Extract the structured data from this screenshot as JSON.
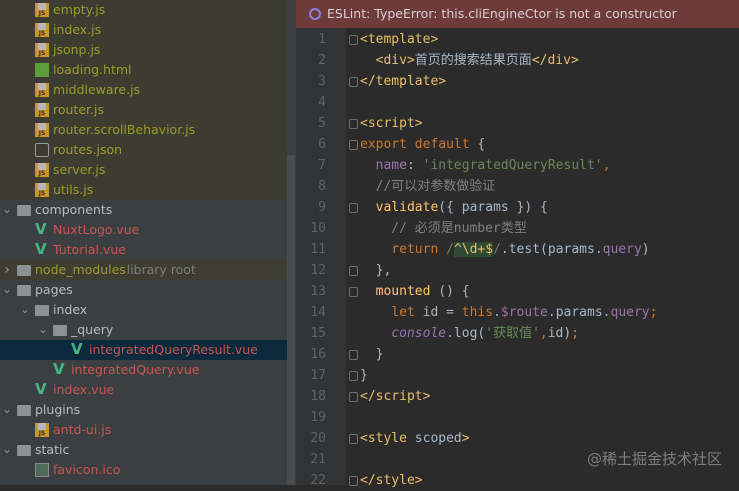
{
  "tree": [
    {
      "label": "empty.js",
      "icon": "js",
      "level": 1,
      "color": "olive",
      "bg": "olive"
    },
    {
      "label": "index.js",
      "icon": "js",
      "level": 1,
      "color": "olive",
      "bg": "olive"
    },
    {
      "label": "jsonp.js",
      "icon": "js",
      "level": 1,
      "color": "olive",
      "bg": "olive"
    },
    {
      "label": "loading.html",
      "icon": "html",
      "level": 1,
      "color": "olive",
      "bg": "olive"
    },
    {
      "label": "middleware.js",
      "icon": "js",
      "level": 1,
      "color": "olive",
      "bg": "olive"
    },
    {
      "label": "router.js",
      "icon": "js",
      "level": 1,
      "color": "olive",
      "bg": "olive"
    },
    {
      "label": "router.scrollBehavior.js",
      "icon": "js",
      "level": 1,
      "color": "olive",
      "bg": "olive"
    },
    {
      "label": "routes.json",
      "icon": "json",
      "level": 1,
      "color": "olive",
      "bg": "olive"
    },
    {
      "label": "server.js",
      "icon": "js",
      "level": 1,
      "color": "olive",
      "bg": "olive"
    },
    {
      "label": "utils.js",
      "icon": "js",
      "level": 1,
      "color": "olive",
      "bg": "olive"
    },
    {
      "label": "components",
      "icon": "folder",
      "level": 0,
      "color": "grey",
      "chevron": "open"
    },
    {
      "label": "NuxtLogo.vue",
      "icon": "vue",
      "level": 1,
      "color": "red"
    },
    {
      "label": "Tutorial.vue",
      "icon": "vue",
      "level": 1,
      "color": "red"
    },
    {
      "label": "node_modules",
      "suffix": "library root",
      "icon": "folder",
      "level": 0,
      "color": "olive",
      "chevron": "closed",
      "bg": "nm"
    },
    {
      "label": "pages",
      "icon": "folder",
      "level": 0,
      "color": "grey",
      "chevron": "open"
    },
    {
      "label": "index",
      "icon": "folder",
      "level": 1,
      "color": "grey",
      "chevron": "open"
    },
    {
      "label": "_query",
      "icon": "folder",
      "level": 2,
      "color": "grey",
      "chevron": "open"
    },
    {
      "label": "integratedQueryResult.vue",
      "icon": "vue",
      "level": 3,
      "color": "red",
      "bg": "sel"
    },
    {
      "label": "integratedQuery.vue",
      "icon": "vue",
      "level": 2,
      "color": "red"
    },
    {
      "label": "index.vue",
      "icon": "vue",
      "level": 1,
      "color": "red"
    },
    {
      "label": "plugins",
      "icon": "folder",
      "level": 0,
      "color": "grey",
      "chevron": "open"
    },
    {
      "label": "antd-ui.js",
      "icon": "js",
      "level": 1,
      "color": "red"
    },
    {
      "label": "static",
      "icon": "folder",
      "level": 0,
      "color": "grey",
      "chevron": "open"
    },
    {
      "label": "favicon.ico",
      "icon": "image",
      "level": 1,
      "color": "red"
    }
  ],
  "banner": {
    "text": "ESLint: TypeError: this.cliEngineCtor is not a constructor",
    "icon": "eslint-error-icon"
  },
  "code": [
    {
      "n": "1",
      "fold": true,
      "t": [
        [
          "tag",
          "<template>"
        ]
      ]
    },
    {
      "n": "2",
      "t": [
        [
          "",
          "  "
        ],
        [
          "tag",
          "<div>"
        ],
        [
          "",
          "首页的搜索结果页面"
        ],
        [
          "tag",
          "</div>"
        ]
      ]
    },
    {
      "n": "3",
      "fold": true,
      "t": [
        [
          "tag",
          "</template>"
        ]
      ]
    },
    {
      "n": "4",
      "t": []
    },
    {
      "n": "5",
      "fold": true,
      "t": [
        [
          "tag",
          "<script>"
        ]
      ]
    },
    {
      "n": "6",
      "fold": true,
      "t": [
        [
          "kw",
          "export default "
        ],
        [
          "",
          "{"
        ]
      ]
    },
    {
      "n": "7",
      "t": [
        [
          "",
          "  "
        ],
        [
          "prop",
          "name"
        ],
        [
          "",
          ": "
        ],
        [
          "str",
          "'integratedQueryResult'"
        ],
        [
          "kw",
          ","
        ]
      ]
    },
    {
      "n": "8",
      "t": [
        [
          "cm",
          "  //可以对参数做验证"
        ]
      ]
    },
    {
      "n": "9",
      "fold": true,
      "t": [
        [
          "",
          "  "
        ],
        [
          "fn",
          "validate"
        ],
        [
          "",
          "({ params }) {"
        ]
      ]
    },
    {
      "n": "10",
      "t": [
        [
          "cm",
          "    // 必须是number类型"
        ]
      ]
    },
    {
      "n": "11",
      "t": [
        [
          "",
          "    "
        ],
        [
          "kw",
          "return "
        ],
        [
          "rx",
          "/"
        ],
        [
          "rxh",
          "^\\d+$"
        ],
        [
          "rx",
          "/"
        ],
        [
          "",
          ".test(params."
        ],
        [
          "prop",
          "query"
        ],
        [
          "",
          ")"
        ]
      ]
    },
    {
      "n": "12",
      "fold": true,
      "t": [
        [
          "",
          "  },"
        ]
      ]
    },
    {
      "n": "13",
      "fold": true,
      "t": [
        [
          "",
          "  "
        ],
        [
          "fn",
          "mounted"
        ],
        [
          "",
          " () {"
        ]
      ]
    },
    {
      "n": "14",
      "t": [
        [
          "",
          "    "
        ],
        [
          "kw",
          "let "
        ],
        [
          "",
          "id = "
        ],
        [
          "kw",
          "this"
        ],
        [
          "",
          "."
        ],
        [
          "prop",
          "$route"
        ],
        [
          "",
          ".params."
        ],
        [
          "prop",
          "query"
        ],
        [
          "kw",
          ";"
        ]
      ]
    },
    {
      "n": "15",
      "t": [
        [
          "",
          "    "
        ],
        [
          "it",
          "console"
        ],
        [
          "",
          ".log("
        ],
        [
          "str",
          "'获取值'"
        ],
        [
          "kw",
          ","
        ],
        [
          "",
          "id)"
        ],
        [
          "kw",
          ";"
        ]
      ]
    },
    {
      "n": "16",
      "fold": true,
      "t": [
        [
          "",
          "  }"
        ]
      ]
    },
    {
      "n": "17",
      "fold": true,
      "t": [
        [
          "",
          "}"
        ]
      ]
    },
    {
      "n": "18",
      "fold": true,
      "t": [
        [
          "tag",
          "</script>"
        ]
      ]
    },
    {
      "n": "19",
      "t": []
    },
    {
      "n": "20",
      "fold": true,
      "t": [
        [
          "tag",
          "<style "
        ],
        [
          "",
          "scoped"
        ],
        [
          "tag",
          ">"
        ]
      ]
    },
    {
      "n": "21",
      "t": []
    },
    {
      "n": "22",
      "fold": true,
      "t": [
        [
          "tag",
          "</style>"
        ]
      ]
    }
  ],
  "watermark": "@稀土掘金技术社区"
}
